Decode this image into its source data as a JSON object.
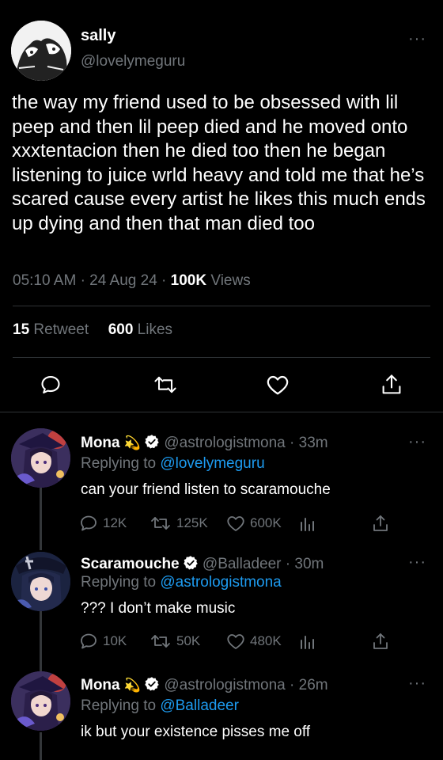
{
  "main": {
    "name": "sally",
    "handle": "@lovelymeguru",
    "text": "the way my friend used to be obsessed with lil peep and then lil peep died and he moved onto xxxtentacion then he died too then he began listening to juice wrld heavy and told me that he’s scared cause every artist he likes this much ends up dying and then that man died too",
    "time": "05:10 AM",
    "date": "24 Aug 24",
    "dot": "·",
    "views_count": "100K",
    "views_label": "Views",
    "retweet_count": "15",
    "retweet_label": "Retweet",
    "likes_count": "600",
    "likes_label": "Likes"
  },
  "replies": [
    {
      "name": "Mona",
      "emoji": "💫",
      "handle": "@astrologistmona",
      "age": "· 33m",
      "replying_prefix": "Replying to ",
      "replying_to": "@lovelymeguru",
      "text": "can your friend listen to scaramouche",
      "replies": "12K",
      "retweets": "125K",
      "likes": "600K"
    },
    {
      "name": "Scaramouche",
      "handle": "@Balladeer",
      "age": "· 30m",
      "replying_prefix": "Replying to ",
      "replying_to": "@astrologistmona",
      "text": "??? I don’t make music",
      "replies": "10K",
      "retweets": "50K",
      "likes": "480K"
    },
    {
      "name": "Mona",
      "emoji": "💫",
      "handle": "@astrologistmona",
      "age": "· 26m",
      "replying_prefix": "Replying to ",
      "replying_to": "@Balladeer",
      "text": "ik but your existence pisses me off"
    }
  ]
}
